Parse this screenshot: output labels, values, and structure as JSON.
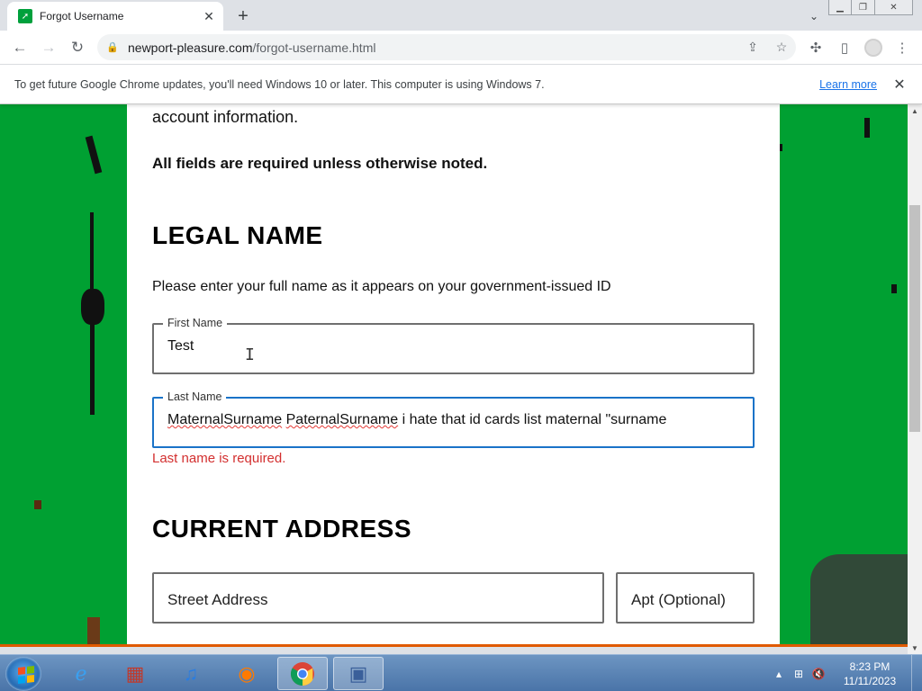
{
  "browser": {
    "tab_title": "Forgot Username",
    "url_host": "newport-pleasure.com",
    "url_path": "/forgot-username.html"
  },
  "infobar": {
    "message": "To get future Google Chrome updates, you'll need Windows 10 or later. This computer is using Windows 7.",
    "link": "Learn more"
  },
  "page": {
    "intro_tail": "account information.",
    "required_note": "All fields are required unless otherwise noted.",
    "legal_heading": "LEGAL NAME",
    "legal_help": "Please enter your full name as it appears on your government-issued ID",
    "first_name": {
      "label": "First Name",
      "value": "Test"
    },
    "last_name": {
      "label": "Last Name",
      "value_misspelled_1": "MaternalSurname",
      "value_misspelled_2": "PaternalSurname",
      "value_rest": "i hate that id cards list maternal \"surname"
    },
    "last_name_error": "Last name is required.",
    "address_heading": "CURRENT ADDRESS",
    "street_placeholder": "Street Address",
    "apt_placeholder": "Apt (Optional)"
  },
  "taskbar": {
    "time": "8:23 PM",
    "date": "11/11/2023",
    "apps": [
      "internet-explorer",
      "archive",
      "itunes",
      "firefox",
      "chrome",
      "remote-desktop"
    ]
  },
  "colors": {
    "page_background": "#00a032",
    "error": "#d32f2f",
    "focus": "#1a73c8"
  }
}
